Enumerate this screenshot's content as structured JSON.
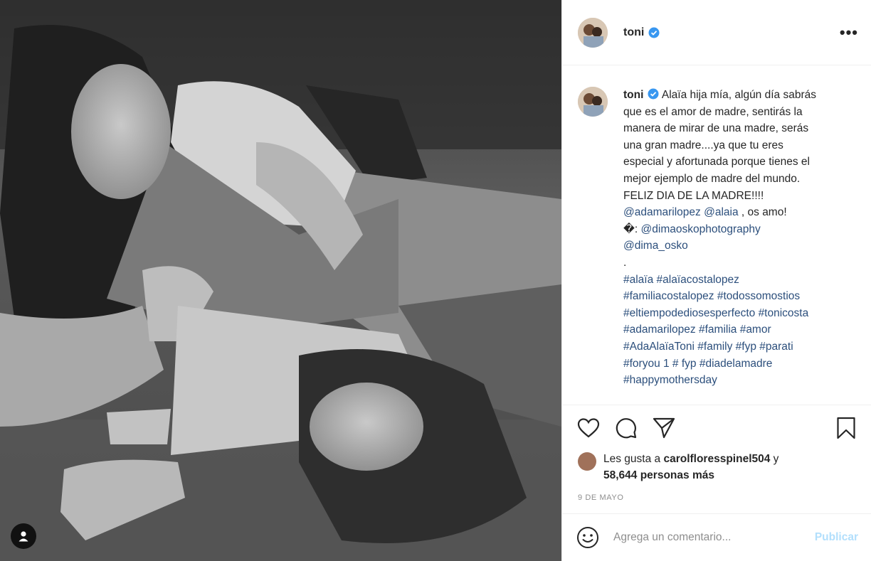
{
  "post": {
    "username": "toni",
    "more_label": "•••",
    "caption_lines": [
      "Alaïa hija mía, algún día sabrás",
      "que es el amor de madre, sentirás la",
      "manera de mirar de una madre, serás",
      "una gran madre....ya que tu eres",
      "especial y afortunada porque tienes el",
      "mejor ejemplo de madre del mundo.",
      "FELIZ DIA DE LA MADRE!!!!"
    ],
    "mention_1": "@adamarilopez",
    "mention_2": "@alaia",
    "mention_suffix": " , os amo!",
    "photo_credit_prefix": "�: ",
    "photo_credit_1": "@dimaoskophotography",
    "photo_credit_2": "@dima_osko",
    "dot_line": ".",
    "hashtag_lines": [
      "#alaïa #alaïacostalopez",
      "#familiacostalopez #todossomostios",
      "#eltiempodediosesperfecto #tonicosta",
      "#adamarilopez #familia #amor",
      "#AdaAlaïaToni #family #fyp #parati",
      "#foryou 1 # fyp #diadelamadre",
      "#happymothersday"
    ],
    "likes_prefix": "Les gusta a ",
    "likes_user": "carolfloresspinel504",
    "likes_mid": " y",
    "likes_count": "58,644 personas más",
    "date": "9 DE MAYO",
    "comment_placeholder": "Agrega un comentario...",
    "publish_label": "Publicar"
  },
  "icons": {
    "verified": "verified-badge-icon",
    "like": "heart-icon",
    "comment": "comment-bubble-icon",
    "share": "paper-plane-icon",
    "save": "bookmark-icon",
    "emoji": "emoji-icon",
    "tag": "user-tag-icon"
  },
  "colors": {
    "verified": "#3897f0",
    "link": "#2c4f7c",
    "publish": "#b2dffc",
    "muted": "#8e8e8e"
  }
}
